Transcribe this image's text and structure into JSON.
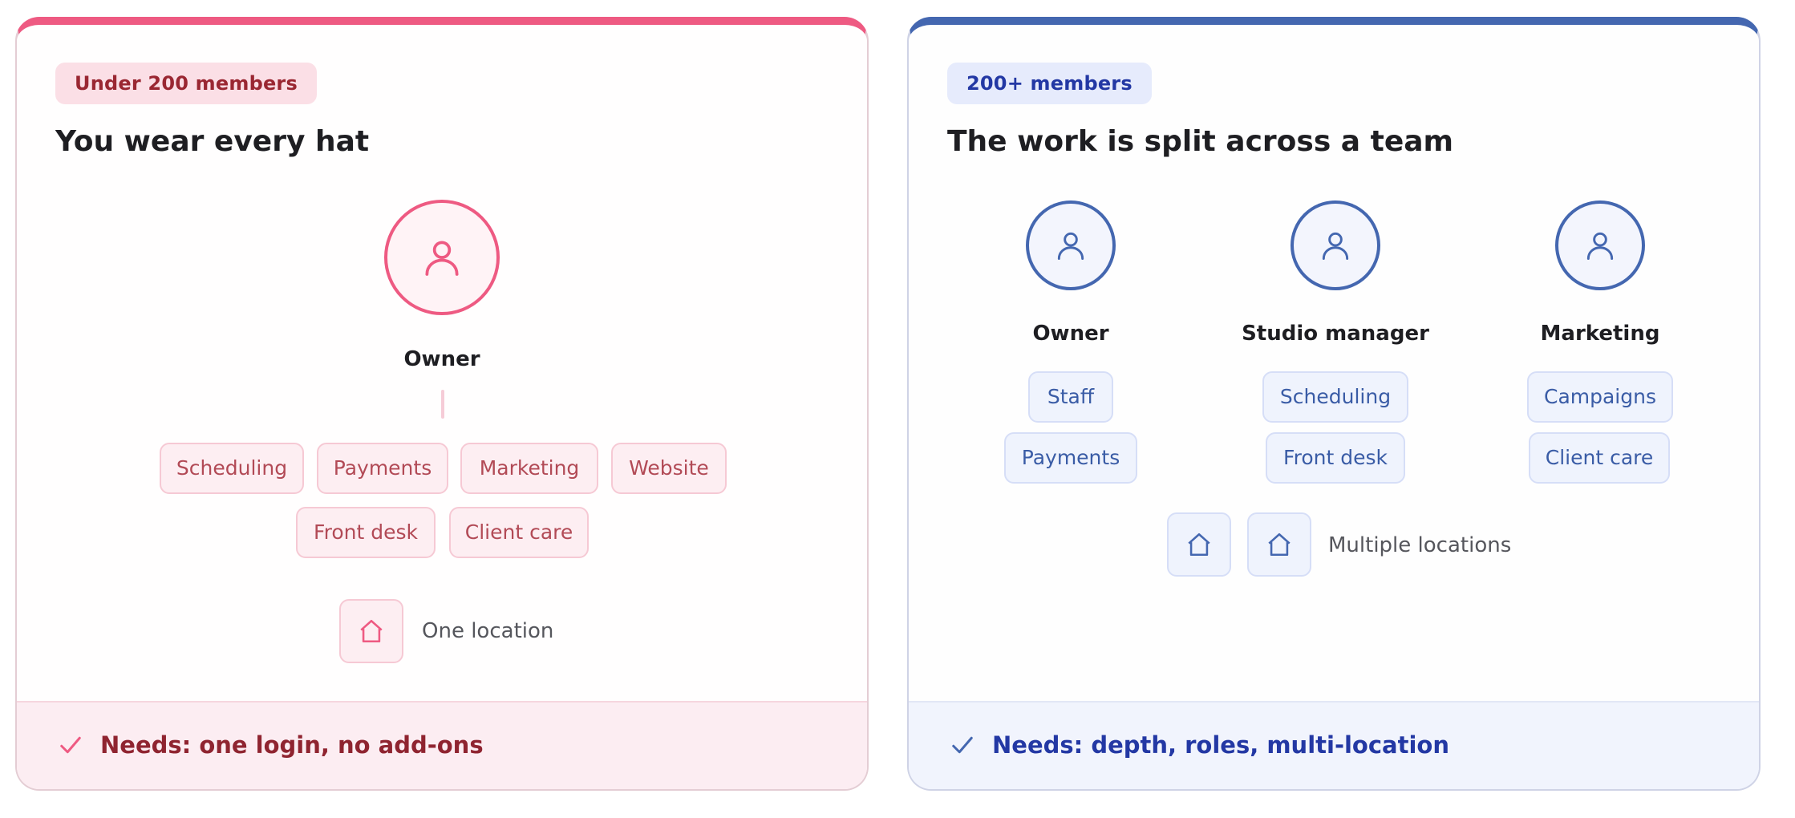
{
  "colors": {
    "small_accent": "#ee5a82",
    "large_accent": "#4467b0",
    "small_text": "#9a2732",
    "large_text": "#2338a4"
  },
  "small_segment": {
    "badge": "Under 200 members",
    "headline": "You wear every hat",
    "avatar_icon": "person-icon",
    "role": "Owner",
    "chips": [
      "Scheduling",
      "Payments",
      "Marketing",
      "Website",
      "Front desk",
      "Client care"
    ],
    "location_icon": "home-icon",
    "location_label": "One location",
    "footer_icon": "check-icon",
    "footer_text": "Needs: one login, no add-ons"
  },
  "large_segment": {
    "badge": "200+ members",
    "headline": "The work is split across a team",
    "roles": [
      {
        "name": "Owner",
        "chips": [
          "Staff",
          "Payments"
        ]
      },
      {
        "name": "Studio manager",
        "chips": [
          "Scheduling",
          "Front desk"
        ]
      },
      {
        "name": "Marketing",
        "chips": [
          "Campaigns",
          "Client care"
        ]
      }
    ],
    "avatar_icon": "person-icon",
    "location_icon": "home-icon",
    "location_label": "Multiple locations",
    "footer_icon": "check-icon",
    "footer_text": "Needs: depth, roles, multi-location"
  }
}
